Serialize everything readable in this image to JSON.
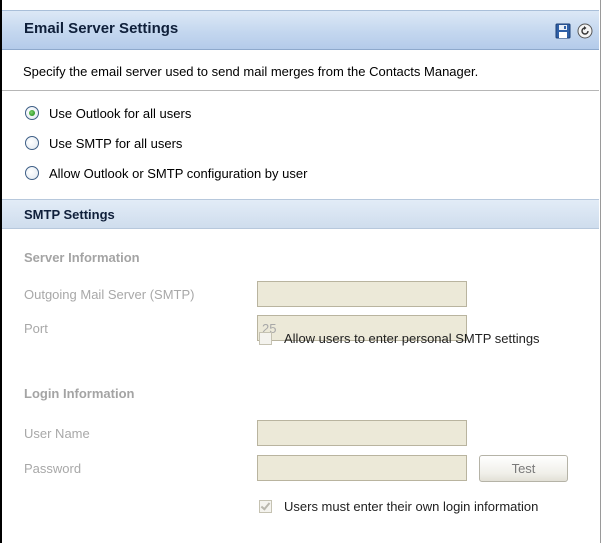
{
  "header": {
    "title": "Email Server Settings",
    "icons": [
      "save-icon",
      "refresh-icon"
    ]
  },
  "description": "Specify the email server used to send mail merges from the Contacts Manager.",
  "mail_options": [
    {
      "label": "Use Outlook for all users",
      "checked": true
    },
    {
      "label": "Use SMTP for all users",
      "checked": false
    },
    {
      "label": "Allow Outlook or SMTP configuration by user",
      "checked": false
    }
  ],
  "smtp": {
    "section_title": "SMTP Settings",
    "server_info": {
      "heading": "Server Information",
      "outgoing_label": "Outgoing Mail Server (SMTP)",
      "outgoing_value": "",
      "port_label": "Port",
      "port_value": "25",
      "allow_personal_label": "Allow users to enter personal SMTP settings",
      "allow_personal_checked": false
    },
    "login_info": {
      "heading": "Login Information",
      "username_label": "User Name",
      "username_value": "",
      "password_label": "Password",
      "password_value": "",
      "test_button_label": "Test",
      "own_login_label": "Users must enter their own login information",
      "own_login_checked": true
    }
  },
  "colors": {
    "header_gradient_top": "#dce8f6",
    "header_gradient_bottom": "#b4cbea",
    "disabled_text": "#a8a8a8",
    "disabled_input_bg": "#ece9d8"
  }
}
